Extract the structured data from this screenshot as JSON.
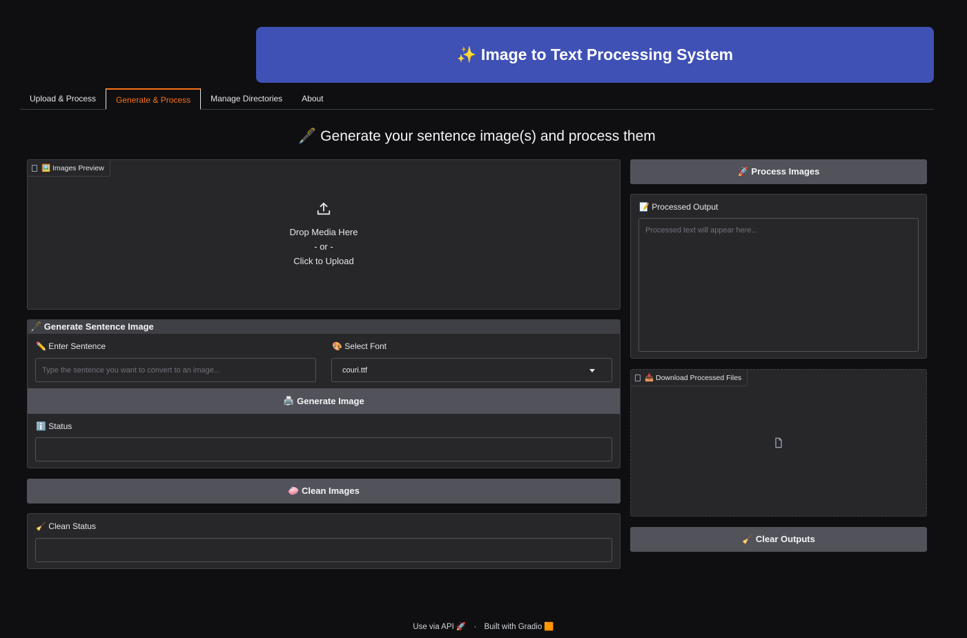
{
  "app": {
    "title": "✨ Image to Text Processing System"
  },
  "tabs": [
    {
      "label": "Upload & Process"
    },
    {
      "label": "Generate & Process"
    },
    {
      "label": "Manage Directories"
    },
    {
      "label": "About"
    }
  ],
  "active_tab": "Generate & Process",
  "subtitle": "🖋️ Generate your sentence image(s) and process them",
  "images_preview": {
    "label": "🖼️ Images Preview",
    "drop_text": "Drop Media Here",
    "or_text": "- or -",
    "click_text": "Click to Upload"
  },
  "generate": {
    "header": "🖋️ Generate Sentence Image",
    "sentence_label": "✏️ Enter Sentence",
    "sentence_placeholder": "Type the sentence you want to convert to an image...",
    "font_label": "🎨 Select Font",
    "font_value": "couri.ttf",
    "button_label": "🖨️ Generate Image",
    "status_label": "ℹ️ Status",
    "status_value": ""
  },
  "clean": {
    "button_label": "🧼 Clean Images",
    "status_label": "🧹 Clean Status",
    "status_value": ""
  },
  "right": {
    "process_button": "🚀 Process Images",
    "output_label": "📝 Processed Output",
    "output_placeholder": "Processed text will appear here...",
    "download_label": "📥 Download Processed Files",
    "clear_button": "🧹 Clear Outputs"
  },
  "footer": {
    "api": "Use via API 🚀",
    "sep": "·",
    "built": "Built with Gradio 🟧"
  },
  "colors": {
    "background": "#0f0f11",
    "banner": "#3f51b5",
    "accent": "#f97316",
    "panel": "#27272a",
    "button": "#52525b"
  }
}
